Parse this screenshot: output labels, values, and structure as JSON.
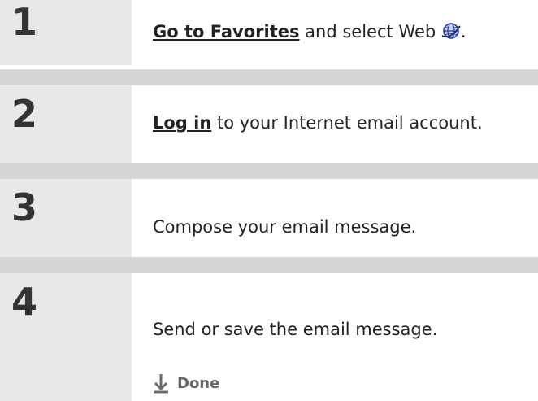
{
  "steps": [
    {
      "number": "1",
      "link_text": "Go to Favorites",
      "text": " and select Web",
      "suffix": "."
    },
    {
      "number": "2",
      "link_text": "Log in",
      "text": " to your Internet email account."
    },
    {
      "number": "3",
      "text": "Compose your email message."
    },
    {
      "number": "4",
      "text": "Send or save the email message."
    }
  ],
  "done": {
    "label": "Done",
    "icon": "down-arrow-icon"
  },
  "icons": {
    "web": "globe-icon"
  },
  "colors": {
    "number_bg": "#e8e8e8",
    "separator": "#d6d6d6",
    "text": "#222222",
    "done_label": "#666666",
    "done_arrow": "#6b6b6b"
  }
}
